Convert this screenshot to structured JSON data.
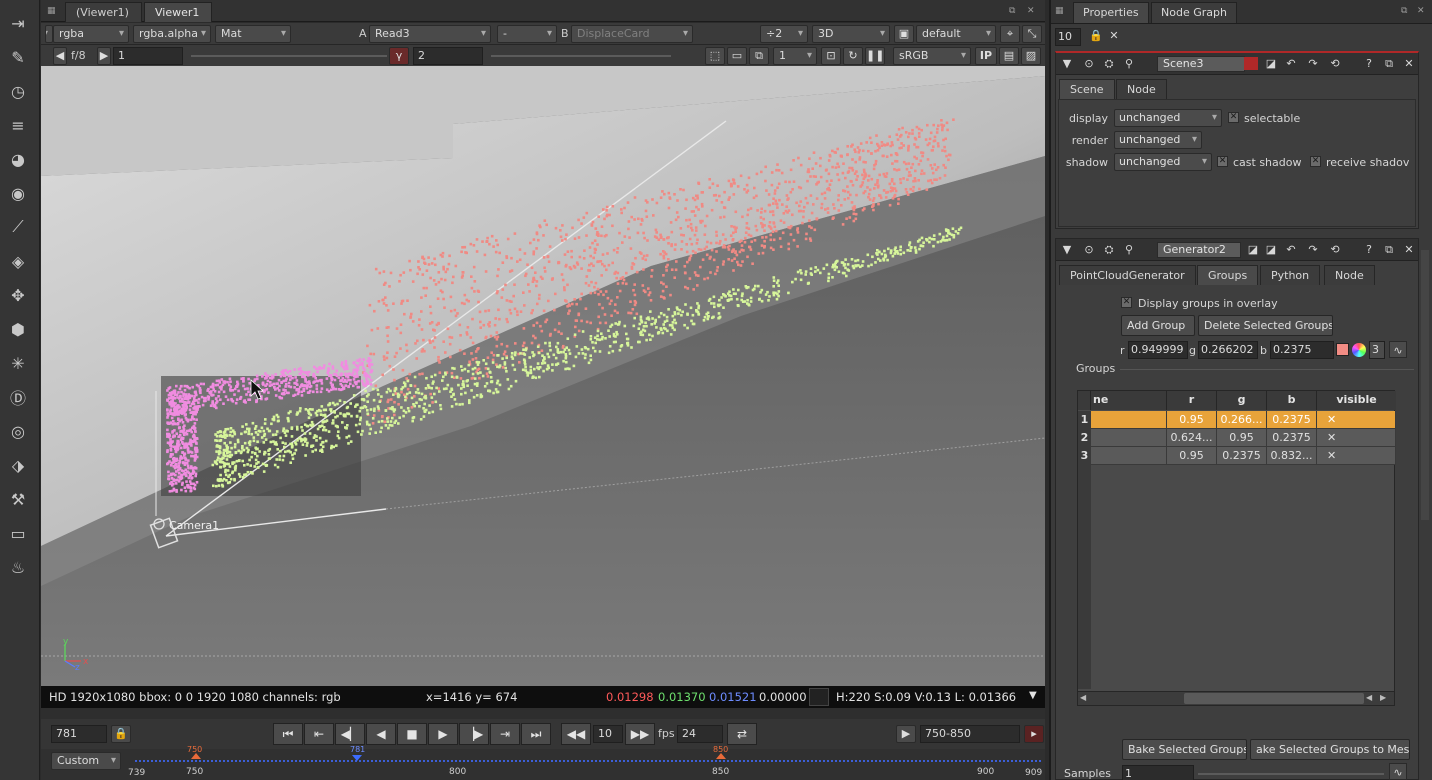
{
  "viewer": {
    "tabs": [
      "(Viewer1)",
      "Viewer1"
    ],
    "row1": {
      "channels": "rgba",
      "alpha": "rgba.alpha",
      "mat": "Mat",
      "a_label": "A",
      "a_input": "Read3",
      "op": "-",
      "b_label": "B",
      "b_input": "DisplaceCard",
      "downrez": "÷2",
      "view_mode": "3D",
      "camera": "default"
    },
    "row2": {
      "fstop": "f/8",
      "gain": "1",
      "gamma": "2",
      "proxy": "1",
      "lut": "sRGB",
      "ip": "IP"
    },
    "camera_label": "Camera1",
    "axis": {
      "y": "y",
      "x": "x",
      "z": "z"
    },
    "info": {
      "format": "HD 1920x1080 bbox: 0 0 1920 1080 channels: rgb",
      "coords": "x=1416 y= 674",
      "r": "0.01298",
      "g": "0.01370",
      "b": "0.01521",
      "a": "0.00000",
      "hsvl": "H:220 S:0.09 V:0.13  L: 0.01366"
    },
    "playback": {
      "frame": "781",
      "step": "10",
      "fps_label": "fps",
      "fps": "24",
      "range": "750-850",
      "range_mode": "Custom"
    },
    "timeline": {
      "start": "739",
      "in": "750",
      "current": "781",
      "out": "850",
      "marks": [
        "750",
        "800",
        "850",
        "900"
      ],
      "end": "909"
    }
  },
  "properties": {
    "tabs": [
      "Properties",
      "Node Graph"
    ],
    "max_panels": "10",
    "scene": {
      "name": "Scene3",
      "tabs": [
        "Scene",
        "Node"
      ],
      "display_label": "display",
      "display": "unchanged",
      "selectable": "selectable",
      "render_label": "render",
      "render": "unchanged",
      "shadow_label": "shadow",
      "shadow": "unchanged",
      "cast_shadow": "cast shadow",
      "receive_shadow": "receive shadov"
    },
    "generator": {
      "name": "Generator2",
      "tabs": [
        "PointCloudGenerator",
        "Groups",
        "Python",
        "Node"
      ],
      "display_groups": "Display groups in overlay",
      "add_group": "Add Group",
      "delete_groups": "Delete Selected Groups",
      "r_label": "r",
      "r": "0.949999",
      "g_label": "g",
      "g": "0.266202",
      "b_label": "b",
      "b": "0.2375",
      "count": "3",
      "groups_label": "Groups",
      "columns": [
        "ne",
        "r",
        "g",
        "b",
        "visible"
      ],
      "rows": [
        {
          "idx": "1",
          "name": "",
          "r": "0.95",
          "g": "0.266...",
          "b": "0.2375",
          "visible": "✕"
        },
        {
          "idx": "2",
          "name": "",
          "r": "0.624...",
          "g": "0.95",
          "b": "0.2375",
          "visible": "✕"
        },
        {
          "idx": "3",
          "name": "",
          "r": "0.95",
          "g": "0.2375",
          "b": "0.832...",
          "visible": "✕"
        }
      ],
      "bake_groups": "Bake Selected Groups",
      "bake_mesh": "ake Selected Groups to Mes",
      "samples_label": "Samples",
      "samples": "1"
    }
  },
  "colors": {
    "pink_points": "#f08a84",
    "green_points": "#d6f59a",
    "magenta_points": "#f08ce0",
    "selected_row": "#e8a33a"
  }
}
